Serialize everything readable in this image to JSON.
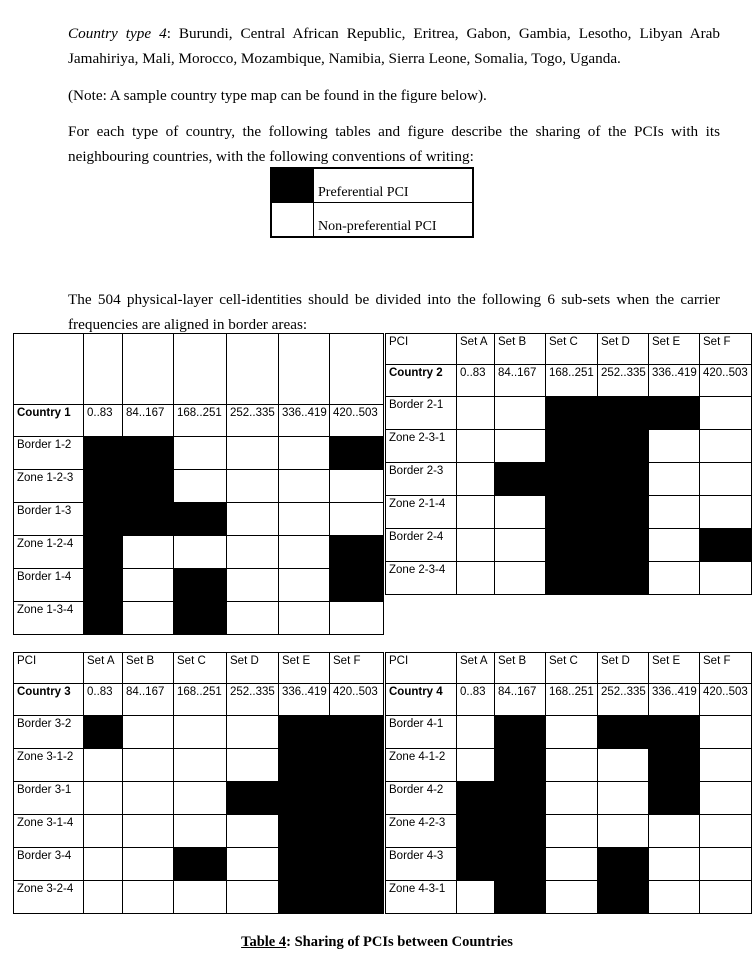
{
  "document": {
    "paragraphs": {
      "country_type_label": "Country type 4",
      "country_type_body": ": Burundi, Central African Republic, Eritrea, Gabon, Gambia, Lesotho, Libyan Arab Jamahiriya, Mali, Morocco, Mozambique, Namibia, Sierra Leone, Somalia, Togo, Uganda.",
      "note": "(Note: A sample country type map can be found in the figure below).",
      "convention": "For each type of country, the following tables and figure describe the sharing of the PCIs with its neighbouring countries, with the following conventions of writing:",
      "subsets": "The 504 physical-layer cell-identities should be divided into the following 6 sub-sets when the carrier frequencies are aligned in border areas:"
    },
    "legend": {
      "preferential_label": "Preferential PCI",
      "non_preferential_label": "Non-preferential PCI",
      "fill_color": "#000000",
      "empty_color": "#ffffff"
    },
    "caption": {
      "label": "Table 4",
      "rest": ": Sharing of PCIs between Countries"
    }
  },
  "tables": [
    {
      "id": "country-1",
      "header": {
        "pci": "",
        "sets": [
          "",
          "",
          "",
          "",
          "",
          ""
        ]
      },
      "country_row": {
        "label": "Country 1",
        "ranges": [
          "0..83",
          "84..167",
          "168..251",
          "252..335",
          "336..419",
          "420..503"
        ]
      },
      "rows": [
        {
          "label": "Border 1-2",
          "cells": [
            1,
            1,
            0,
            0,
            0,
            1
          ]
        },
        {
          "label": "Zone 1-2-3",
          "cells": [
            1,
            1,
            0,
            0,
            0,
            0
          ]
        },
        {
          "label": "Border 1-3",
          "cells": [
            1,
            1,
            1,
            0,
            0,
            0
          ]
        },
        {
          "label": "Zone 1-2-4",
          "cells": [
            1,
            0,
            0,
            0,
            0,
            1
          ]
        },
        {
          "label": "Border 1-4",
          "cells": [
            1,
            0,
            1,
            0,
            0,
            1
          ]
        },
        {
          "label": "Zone 1-3-4",
          "cells": [
            1,
            0,
            1,
            0,
            0,
            0
          ]
        }
      ]
    },
    {
      "id": "country-2",
      "header": {
        "pci": "PCI",
        "sets": [
          "Set A",
          "Set B",
          "Set C",
          "Set D",
          "Set E",
          "Set F"
        ]
      },
      "country_row": {
        "label": "Country 2",
        "ranges": [
          "0..83",
          "84..167",
          "168..251",
          "252..335",
          "336..419",
          "420..503"
        ]
      },
      "rows": [
        {
          "label": "Border 2-1",
          "cells": [
            0,
            0,
            1,
            1,
            1,
            0
          ]
        },
        {
          "label": "Zone 2-3-1",
          "cells": [
            0,
            0,
            1,
            1,
            0,
            0
          ]
        },
        {
          "label": "Border 2-3",
          "cells": [
            0,
            1,
            1,
            1,
            0,
            0
          ]
        },
        {
          "label": "Zone 2-1-4",
          "cells": [
            0,
            0,
            1,
            1,
            0,
            0
          ]
        },
        {
          "label": "Border 2-4",
          "cells": [
            0,
            0,
            1,
            1,
            0,
            1
          ]
        },
        {
          "label": "Zone 2-3-4",
          "cells": [
            0,
            0,
            1,
            1,
            0,
            0
          ]
        }
      ]
    },
    {
      "id": "country-3",
      "header": {
        "pci": "PCI",
        "sets": [
          "Set A",
          "Set B",
          "Set C",
          "Set D",
          "Set E",
          "Set F"
        ]
      },
      "country_row": {
        "label": "Country 3",
        "ranges": [
          "0..83",
          "84..167",
          "168..251",
          "252..335",
          "336..419",
          "420..503"
        ]
      },
      "rows": [
        {
          "label": "Border 3-2",
          "cells": [
            1,
            0,
            0,
            0,
            1,
            1
          ]
        },
        {
          "label": "Zone 3-1-2",
          "cells": [
            0,
            0,
            0,
            0,
            1,
            1
          ]
        },
        {
          "label": "Border 3-1",
          "cells": [
            0,
            0,
            0,
            1,
            1,
            1
          ]
        },
        {
          "label": "Zone 3-1-4",
          "cells": [
            0,
            0,
            0,
            0,
            1,
            1
          ]
        },
        {
          "label": "Border 3-4",
          "cells": [
            0,
            0,
            1,
            0,
            1,
            1
          ]
        },
        {
          "label": "Zone 3-2-4",
          "cells": [
            0,
            0,
            0,
            0,
            1,
            1
          ]
        }
      ]
    },
    {
      "id": "country-4",
      "header": {
        "pci": "PCI",
        "sets": [
          "Set A",
          "Set B",
          "Set C",
          "Set D",
          "Set E",
          "Set F"
        ]
      },
      "country_row": {
        "label": "Country 4",
        "ranges": [
          "0..83",
          "84..167",
          "168..251",
          "252..335",
          "336..419",
          "420..503"
        ]
      },
      "rows": [
        {
          "label": "Border 4-1",
          "cells": [
            0,
            1,
            0,
            1,
            1,
            0
          ]
        },
        {
          "label": "Zone 4-1-2",
          "cells": [
            0,
            1,
            0,
            0,
            1,
            0
          ]
        },
        {
          "label": "Border 4-2",
          "cells": [
            1,
            1,
            0,
            0,
            1,
            0
          ]
        },
        {
          "label": "Zone 4-2-3",
          "cells": [
            1,
            1,
            0,
            0,
            0,
            0
          ]
        },
        {
          "label": "Border 4-3",
          "cells": [
            1,
            1,
            0,
            1,
            0,
            0
          ]
        },
        {
          "label": "Zone 4-3-1",
          "cells": [
            0,
            1,
            0,
            1,
            0,
            0
          ]
        }
      ]
    }
  ]
}
